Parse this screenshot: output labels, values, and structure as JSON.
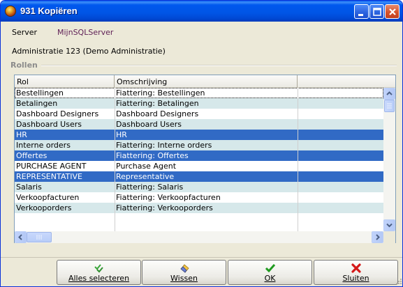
{
  "window": {
    "title": "931 Kopiëren",
    "icon": "app-globe-icon",
    "accent": "#0055e5"
  },
  "info": {
    "server_label": "Server",
    "server_value": "MijnSQLServer",
    "administration": "Administratie 123 (Demo Administratie)"
  },
  "group": {
    "label": "Rollen"
  },
  "grid": {
    "columns": [
      "Rol",
      "Omschrijving",
      ""
    ],
    "rows": [
      {
        "rol": "Bestellingen",
        "omschrijving": "Fiattering: Bestellingen",
        "state": "focus"
      },
      {
        "rol": "Betalingen",
        "omschrijving": "Fiattering: Betalingen",
        "state": "alt"
      },
      {
        "rol": "Dashboard Designers",
        "omschrijving": "Dashboard Designers",
        "state": "plain"
      },
      {
        "rol": "Dashboard Users",
        "omschrijving": "Dashboard Users",
        "state": "alt"
      },
      {
        "rol": "HR",
        "omschrijving": "HR",
        "state": "selected"
      },
      {
        "rol": "Interne orders",
        "omschrijving": "Fiattering: Interne orders",
        "state": "alt"
      },
      {
        "rol": "Offertes",
        "omschrijving": "Fiattering: Offertes",
        "state": "selected"
      },
      {
        "rol": "PURCHASE AGENT",
        "omschrijving": "Purchase Agent",
        "state": "plain"
      },
      {
        "rol": "REPRESENTATIVE",
        "omschrijving": "Representative",
        "state": "selected"
      },
      {
        "rol": "Salaris",
        "omschrijving": "Fiattering: Salaris",
        "state": "alt"
      },
      {
        "rol": "Verkoopfacturen",
        "omschrijving": "Fiattering: Verkoopfacturen",
        "state": "plain"
      },
      {
        "rol": "Verkooporders",
        "omschrijving": "Fiattering: Verkooporders",
        "state": "alt"
      }
    ],
    "selected_color": "#316ac5",
    "alt_color": "#d6e8ea"
  },
  "buttons": {
    "select_all": {
      "label": "Alles selecteren",
      "icon": "select-all-icon"
    },
    "clear": {
      "label": "Wissen",
      "icon": "eraser-icon"
    },
    "ok": {
      "label": "OK",
      "icon": "checkmark-icon"
    },
    "close": {
      "label": "Sluiten",
      "icon": "red-x-icon"
    }
  }
}
